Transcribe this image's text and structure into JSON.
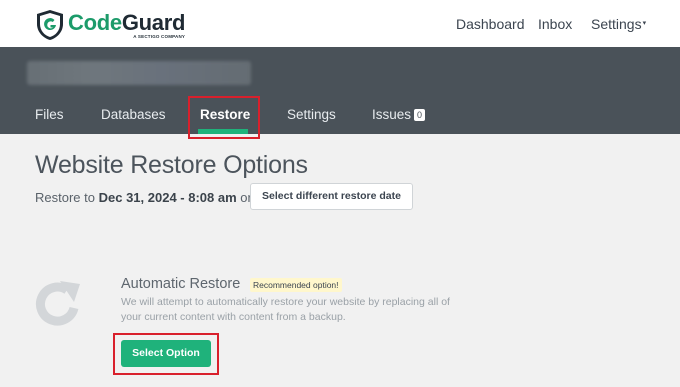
{
  "header": {
    "logo_name_code": "Code",
    "logo_name_guard": "Guard",
    "logo_tagline": "A SECTIGO COMPANY",
    "nav": {
      "dashboard": "Dashboard",
      "inbox": "Inbox",
      "settings": "Settings",
      "settings_caret": "▾"
    }
  },
  "band": {
    "tabs": {
      "files": "Files",
      "databases": "Databases",
      "restore": "Restore",
      "settings": "Settings",
      "issues": "Issues",
      "issues_count": "0"
    }
  },
  "main": {
    "title": "Website Restore Options",
    "restore_to_prefix": "Restore to",
    "restore_date": "Dec 31, 2024 - 8:08 am",
    "restore_or": "or",
    "select_date_button": "Select different restore date",
    "automatic": {
      "title": "Automatic Restore",
      "badge": "Recommended option!",
      "description": "We will attempt to automatically restore your website by replacing all of your current content with content from a backup.",
      "button": "Select Option"
    }
  },
  "colors": {
    "brand_green": "#1fb27b",
    "band_bg": "#4a5259",
    "highlight_red": "#d9202c",
    "badge_yellow": "#fff7cc"
  },
  "icons": {
    "logo": "codeguard-shield-icon",
    "restore": "restore-refresh-icon"
  }
}
